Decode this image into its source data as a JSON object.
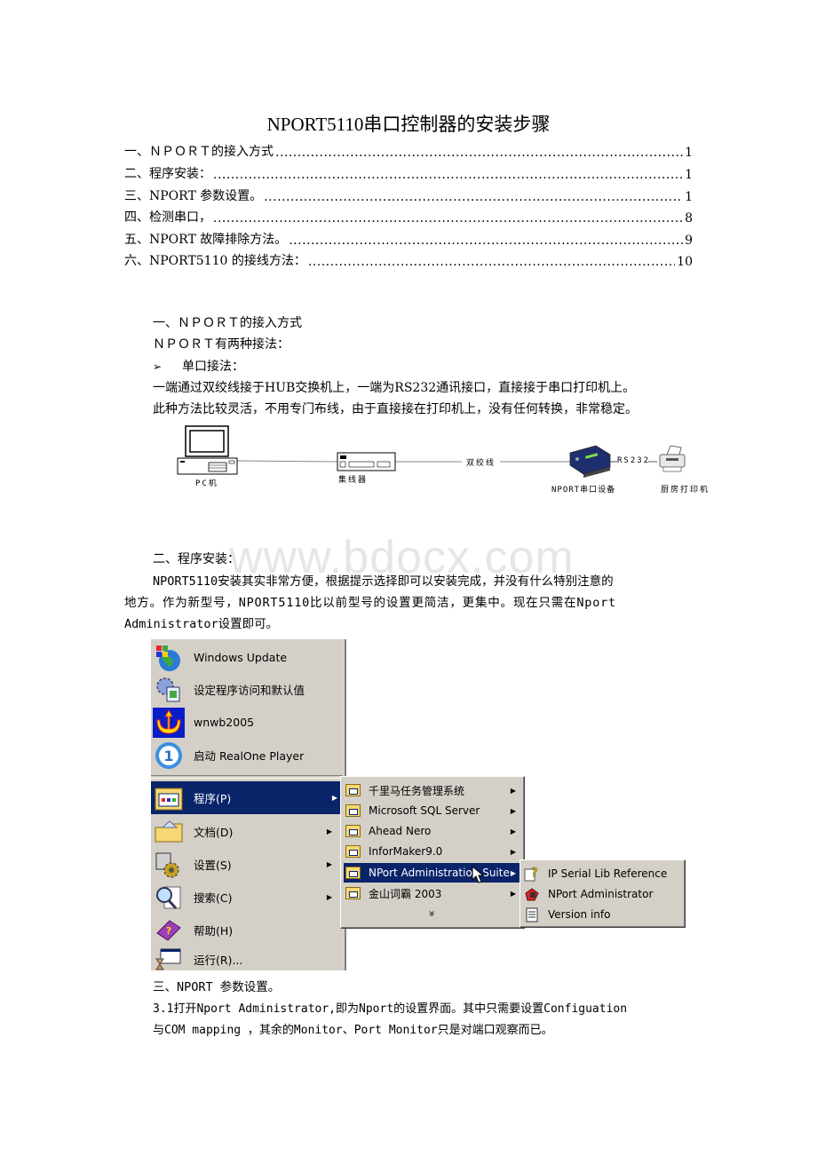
{
  "document": {
    "title": "NPORT5110串口控制器的安装步骤",
    "watermark": "www.bdocx.com"
  },
  "toc": [
    {
      "label": "一、ＮＰＯＲＴ的接入方式",
      "page": "1"
    },
    {
      "label": "二、程序安装：",
      "page": "1"
    },
    {
      "label": "三、NPORT 参数设置。",
      "page": "1"
    },
    {
      "label": "四、检测串口，",
      "page": "8"
    },
    {
      "label": "五、NPORT 故障排除方法。",
      "page": "9"
    },
    {
      "label": "六、NPORT5110 的接线方法：",
      "page": "10"
    }
  ],
  "section1": {
    "heading": "一、ＮＰＯＲＴ的接入方式",
    "intro": "ＮＰＯＲＴ有两种接法：",
    "bullet_symbol": "➢",
    "bullet": "单口接法：",
    "line1": "一端通过双绞线接于HUB交换机上，一端为RS232通讯接口，直接接于串口打印机上。",
    "line2": "此种方法比较灵活，不用专门布线，由于直接接在打印机上，没有任何转换，非常稳定。"
  },
  "diagram": {
    "pc_label": "PC机",
    "hub_label": "集线器",
    "cable_label": "双绞线",
    "nport_label": "NPORT串口设备",
    "rs232_label": "RS232",
    "printer_label": "厨房打印机"
  },
  "section2": {
    "heading": "二、程序安装：",
    "line1": "NPORT5110安装其实非常方便，根据提示选择即可以安装完成，并没有什么特别注意的",
    "line2": "地方。作为新型号，NPORT5110比以前型号的设置更简洁，更集中。现在只需在Nport",
    "line3": "Administrator设置即可。"
  },
  "start_menu": {
    "top_items": [
      {
        "label": "Windows Update",
        "icon": "windows-update-icon"
      },
      {
        "label": "设定程序访问和默认值",
        "icon": "program-access-icon"
      },
      {
        "label": "wnwb2005",
        "icon": "wnwb-trident-icon"
      },
      {
        "label": "启动 RealOne Player",
        "icon": "realone-icon"
      }
    ],
    "items": [
      {
        "label": "程序(P)",
        "icon": "programs-icon",
        "has_submenu": true,
        "selected": true
      },
      {
        "label": "文档(D)",
        "icon": "documents-icon",
        "has_submenu": true
      },
      {
        "label": "设置(S)",
        "icon": "settings-icon",
        "has_submenu": true
      },
      {
        "label": "搜索(C)",
        "icon": "search-icon",
        "has_submenu": true
      },
      {
        "label": "帮助(H)",
        "icon": "help-icon",
        "has_submenu": false
      },
      {
        "label": "运行(R)...",
        "icon": "run-icon",
        "has_submenu": false
      }
    ],
    "programs_submenu": [
      {
        "label": "千里马任务管理系统",
        "selected": false
      },
      {
        "label": "Microsoft SQL Server",
        "selected": false
      },
      {
        "label": "Ahead Nero",
        "selected": false
      },
      {
        "label": "InforMaker9.0",
        "selected": false
      },
      {
        "label": "NPort Administration Suite",
        "selected": true
      },
      {
        "label": "金山词霸 2003",
        "selected": false
      }
    ],
    "expand_symbol": "»",
    "nport_submenu": [
      {
        "label": "IP Serial Lib Reference",
        "icon": "help-document-icon"
      },
      {
        "label": "NPort Administrator",
        "icon": "nport-admin-icon"
      },
      {
        "label": "Version info",
        "icon": "notepad-icon"
      }
    ],
    "arrow_symbol": "▶"
  },
  "section3": {
    "heading": "三、NPORT 参数设置。",
    "line1": "3.1打开Nport Administrator,即为Nport的设置界面。其中只需要设置Configuation",
    "line2": "与COM mapping ，其余的Monitor、Port Monitor只是对端口观察而已。"
  }
}
